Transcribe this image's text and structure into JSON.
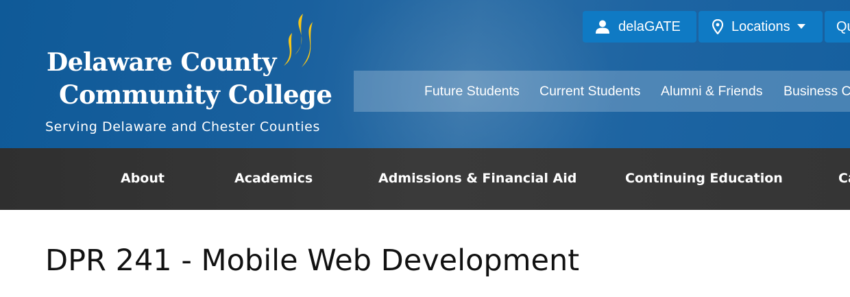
{
  "site": {
    "name_line1": "Delaware County",
    "name_line2": "Community College",
    "tagline": "Serving Delaware and Chester Counties"
  },
  "colors": {
    "header_blue": "#16609f",
    "button_blue": "#0f7ac4",
    "nav_dark": "#353535",
    "flame_yellow": "#f5c518"
  },
  "utility_nav": {
    "items": [
      {
        "label": "delaGATE",
        "icon": "user-icon"
      },
      {
        "label": "Locations",
        "icon": "map-pin-icon",
        "dropdown": true
      },
      {
        "label": "Qu",
        "icon": ""
      }
    ]
  },
  "audience_nav": {
    "items": [
      "Future Students",
      "Current Students",
      "Alumni & Friends",
      "Business C"
    ]
  },
  "main_nav": {
    "items": [
      "About",
      "Academics",
      "Admissions & Financial Aid",
      "Continuing Education",
      "Ca"
    ]
  },
  "page": {
    "title": "DPR 241 - Mobile Web Development"
  }
}
